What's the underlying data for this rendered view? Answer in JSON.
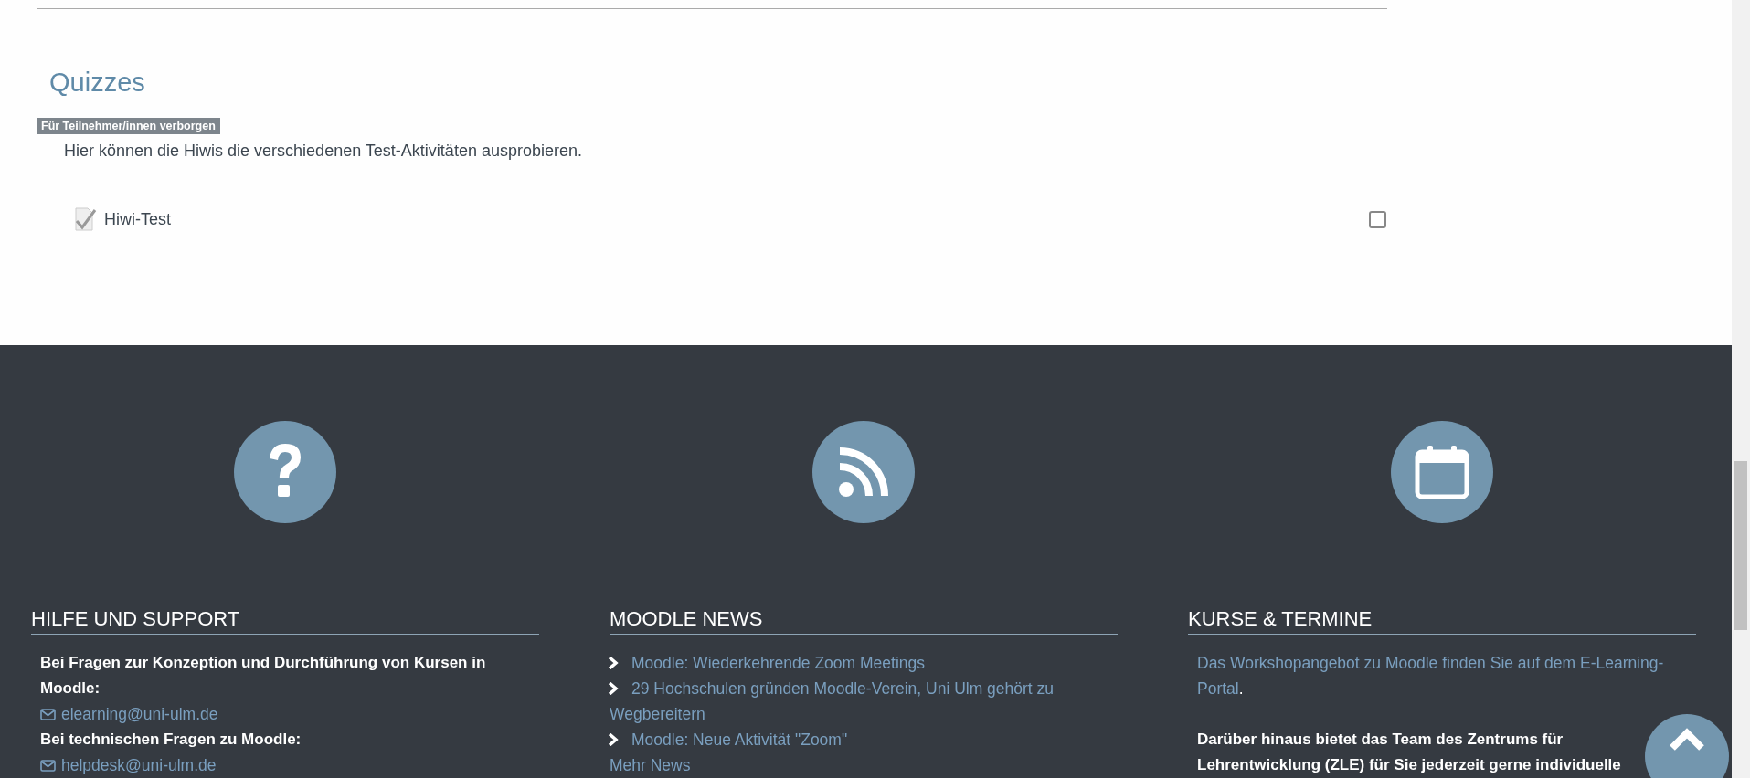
{
  "section": {
    "title": "Quizzes",
    "badge": "Für Teilnehmer/innen verborgen",
    "summary": "Hier können die Hiwis die verschiedenen Test-Aktivitäten ausprobieren.",
    "activities": [
      {
        "name": "Hiwi-Test",
        "completed": false
      }
    ]
  },
  "footer": {
    "columns": [
      {
        "title": "HILFE UND SUPPORT",
        "items": [
          {
            "kind": "text",
            "text": "Bei Fragen zur Konzeption und Durchführung von Kursen in Moodle:"
          },
          {
            "kind": "email",
            "text": "elearning@uni-ulm.de"
          },
          {
            "kind": "text",
            "text": "Bei technischen Fragen zu Moodle:"
          },
          {
            "kind": "email",
            "text": "helpdesk@uni-ulm.de"
          }
        ]
      },
      {
        "title": "MOODLE NEWS",
        "items": [
          {
            "kind": "news",
            "text": "Moodle: Wiederkehrende Zoom Meetings"
          },
          {
            "kind": "news",
            "text": "29 Hochschulen gründen Moodle-Verein, Uni Ulm gehört zu Wegbereitern"
          },
          {
            "kind": "news",
            "text": "Moodle: Neue Aktivität \"Zoom\""
          },
          {
            "kind": "link",
            "text": "Mehr News"
          }
        ]
      },
      {
        "title": "KURSE & TERMINE",
        "items": [
          {
            "kind": "linked",
            "text": "Das Workshopangebot zu Moodle finden Sie auf dem E-Learning-Portal",
            "after": "."
          },
          {
            "kind": "text",
            "text": "Darüber hinaus bietet das Team des Zentrums für Lehrentwicklung (ZLE) für Sie jederzeit gerne individuelle"
          }
        ]
      }
    ]
  }
}
